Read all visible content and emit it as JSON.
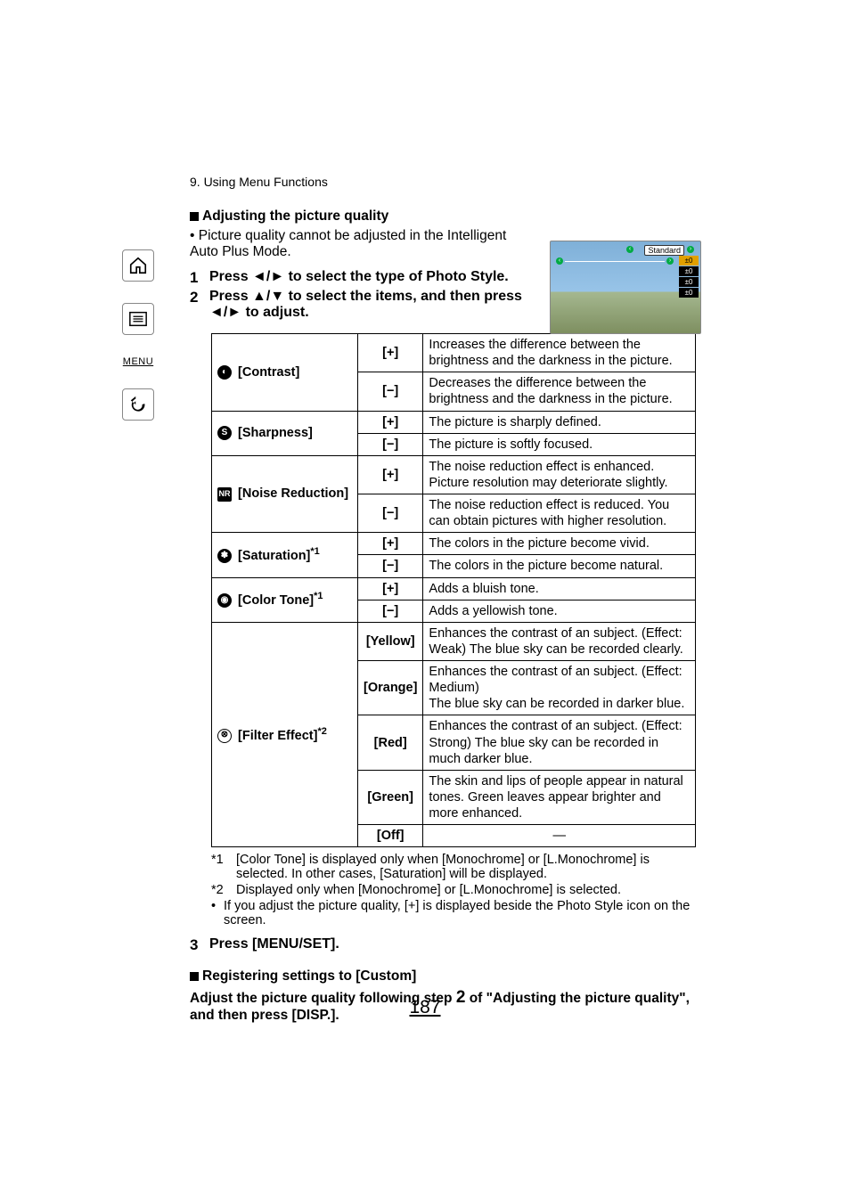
{
  "sidebar": {
    "menu_label": "MENU"
  },
  "chapter": "9. Using Menu Functions",
  "section1": {
    "title": "Adjusting the picture quality",
    "note": "• Picture quality cannot be adjusted in the Intelligent Auto Plus Mode."
  },
  "steps": {
    "s1_num": "1",
    "s1_text": "Press ◄/► to select the type of Photo Style.",
    "s2_num": "2",
    "s2_text": "Press ▲/▼ to select the items, and then press ◄/► to adjust."
  },
  "widget": {
    "pill": "Standard",
    "b1": "±0",
    "b2": "±0",
    "b3": "±0",
    "b4": "±0"
  },
  "table": {
    "contrast": {
      "label": "[Contrast]",
      "plus_val": "[+]",
      "plus_desc": "Increases the difference between the brightness and the darkness in the picture.",
      "minus_val": "[−]",
      "minus_desc": "Decreases the difference between the brightness and the darkness in the picture."
    },
    "sharpness": {
      "label": "[Sharpness]",
      "plus_val": "[+]",
      "plus_desc": "The picture is sharply defined.",
      "minus_val": "[−]",
      "minus_desc": "The picture is softly focused."
    },
    "noise": {
      "label": "[Noise Reduction]",
      "plus_val": "[+]",
      "plus_desc": "The noise reduction effect is enhanced. Picture resolution may deteriorate slightly.",
      "minus_val": "[−]",
      "minus_desc": "The noise reduction effect is reduced. You can obtain pictures with higher resolution."
    },
    "saturation": {
      "label": "[Saturation]",
      "sup": "*1",
      "plus_val": "[+]",
      "plus_desc": "The colors in the picture become vivid.",
      "minus_val": "[−]",
      "minus_desc": "The colors in the picture become natural."
    },
    "colortone": {
      "label": "[Color Tone]",
      "sup": "*1",
      "plus_val": "[+]",
      "plus_desc": "Adds a bluish tone.",
      "minus_val": "[−]",
      "minus_desc": "Adds a yellowish tone."
    },
    "filter": {
      "label": "[Filter Effect]",
      "sup": "*2",
      "yellow_val": "[Yellow]",
      "yellow_desc": "Enhances the contrast of an subject. (Effect: Weak) The blue sky can be recorded clearly.",
      "orange_val": "[Orange]",
      "orange_desc": "Enhances the contrast of an subject. (Effect: Medium)\nThe blue sky can be recorded in darker blue.",
      "red_val": "[Red]",
      "red_desc": "Enhances the contrast of an subject. (Effect: Strong) The blue sky can be recorded in much darker blue.",
      "green_val": "[Green]",
      "green_desc": "The skin and lips of people appear in natural tones. Green leaves appear brighter and more enhanced.",
      "off_val": "[Off]",
      "off_desc": "—"
    }
  },
  "footnotes": {
    "f1_mark": "*1",
    "f1_text": "[Color Tone] is displayed only when [Monochrome] or [L.Monochrome] is selected. In other cases, [Saturation] will be displayed.",
    "f2_mark": "*2",
    "f2_text": "Displayed only when [Monochrome] or [L.Monochrome] is selected.",
    "f3_text": "If you adjust the picture quality, [+] is displayed beside the Photo Style icon on the screen."
  },
  "step3": {
    "num": "3",
    "text": "Press [MENU/SET]."
  },
  "section2": {
    "title": "Registering settings to [Custom]",
    "line_a": "Adjust the picture quality following step ",
    "line_b": "2",
    "line_c": " of \"Adjusting the picture quality\", and then press [DISP.]."
  },
  "page_number": "187"
}
